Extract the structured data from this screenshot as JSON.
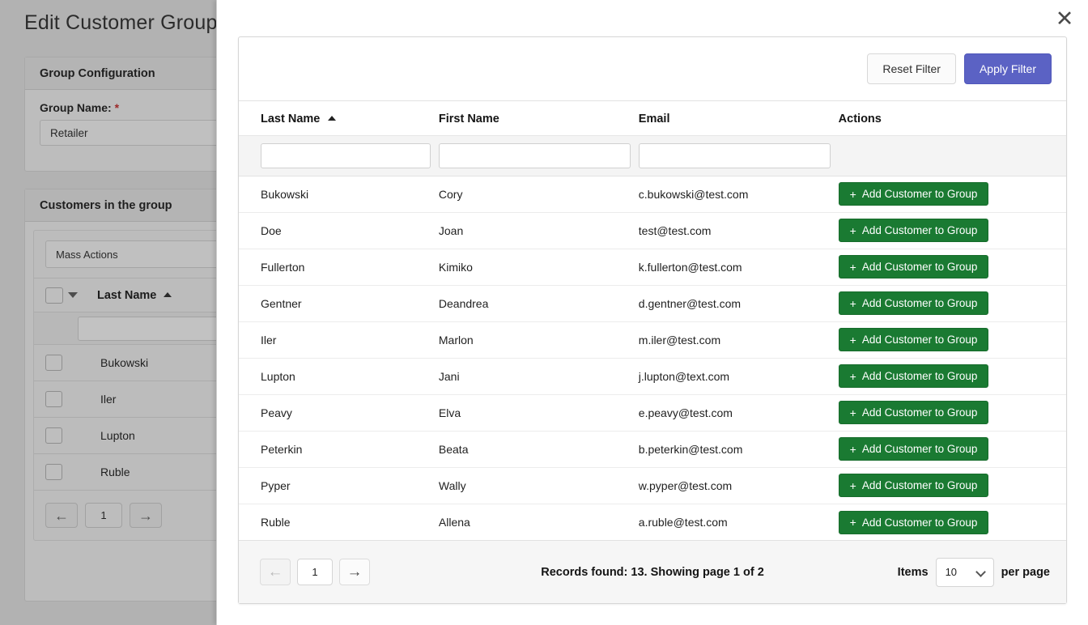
{
  "background": {
    "page_title": "Edit Customer Group",
    "group_config": {
      "header": "Group Configuration",
      "group_name_label": "Group Name:",
      "required_marker": "*",
      "group_name_value": "Retailer"
    },
    "customers_panel": {
      "header": "Customers in the group",
      "mass_actions_label": "Mass Actions",
      "column_last_name": "Last Name",
      "rows": [
        {
          "last_name": "Bukowski"
        },
        {
          "last_name": "Iler"
        },
        {
          "last_name": "Lupton"
        },
        {
          "last_name": "Ruble"
        }
      ],
      "pager": {
        "prev": "←",
        "page": "1",
        "next": "→"
      }
    }
  },
  "modal": {
    "close_label": "✕",
    "toolbar": {
      "reset_label": "Reset Filter",
      "apply_label": "Apply Filter"
    },
    "table": {
      "columns": {
        "last_name": "Last Name",
        "first_name": "First Name",
        "email": "Email",
        "actions": "Actions"
      },
      "filters": {
        "last_name": "",
        "first_name": "",
        "email": ""
      },
      "action_label": "Add Customer to Group",
      "action_plus": "+",
      "rows": [
        {
          "last_name": "Bukowski",
          "first_name": "Cory",
          "email": "c.bukowski@test.com"
        },
        {
          "last_name": "Doe",
          "first_name": "Joan",
          "email": "test@test.com"
        },
        {
          "last_name": "Fullerton",
          "first_name": "Kimiko",
          "email": "k.fullerton@test.com"
        },
        {
          "last_name": "Gentner",
          "first_name": "Deandrea",
          "email": "d.gentner@test.com"
        },
        {
          "last_name": "Iler",
          "first_name": "Marlon",
          "email": "m.iler@test.com"
        },
        {
          "last_name": "Lupton",
          "first_name": "Jani",
          "email": "j.lupton@text.com"
        },
        {
          "last_name": "Peavy",
          "first_name": "Elva",
          "email": "e.peavy@test.com"
        },
        {
          "last_name": "Peterkin",
          "first_name": "Beata",
          "email": "b.peterkin@test.com"
        },
        {
          "last_name": "Pyper",
          "first_name": "Wally",
          "email": "w.pyper@test.com"
        },
        {
          "last_name": "Ruble",
          "first_name": "Allena",
          "email": "a.ruble@test.com"
        }
      ]
    },
    "footer": {
      "prev": "←",
      "page": "1",
      "next": "→",
      "records_text": "Records found: 13. Showing page 1 of 2",
      "items_label": "Items",
      "per_page_value": "10",
      "per_page_label": "per page"
    }
  },
  "colors": {
    "accent_apply": "#5b62c4",
    "accent_add": "#1a7a32",
    "overlay": "#b2b2b2",
    "required": "#9c2828"
  }
}
